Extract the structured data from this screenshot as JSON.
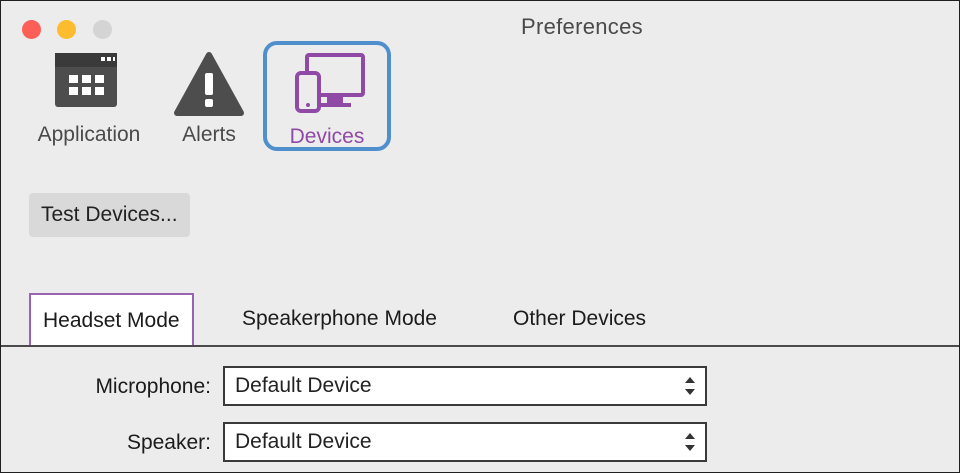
{
  "window": {
    "title": "Preferences"
  },
  "toolbar": {
    "items": [
      {
        "label": "Application",
        "icon": "calendar-grid-icon",
        "selected": false
      },
      {
        "label": "Alerts",
        "icon": "warning-triangle-icon",
        "selected": false
      },
      {
        "label": "Devices",
        "icon": "devices-icon",
        "selected": true
      }
    ]
  },
  "actions": {
    "test_devices_label": "Test Devices..."
  },
  "tabs": [
    {
      "label": "Headset Mode",
      "active": true
    },
    {
      "label": "Speakerphone Mode",
      "active": false
    },
    {
      "label": "Other Devices",
      "active": false
    }
  ],
  "form": {
    "microphone": {
      "label": "Microphone:",
      "value": "Default Device"
    },
    "speaker": {
      "label": "Speaker:",
      "value": "Default Device"
    }
  },
  "colors": {
    "accent": "#8f4aa6",
    "highlight_box": "#4f8fcc",
    "close": "#fc5f57",
    "minimize": "#fdbc2e",
    "maximize": "#d4d4d4"
  }
}
